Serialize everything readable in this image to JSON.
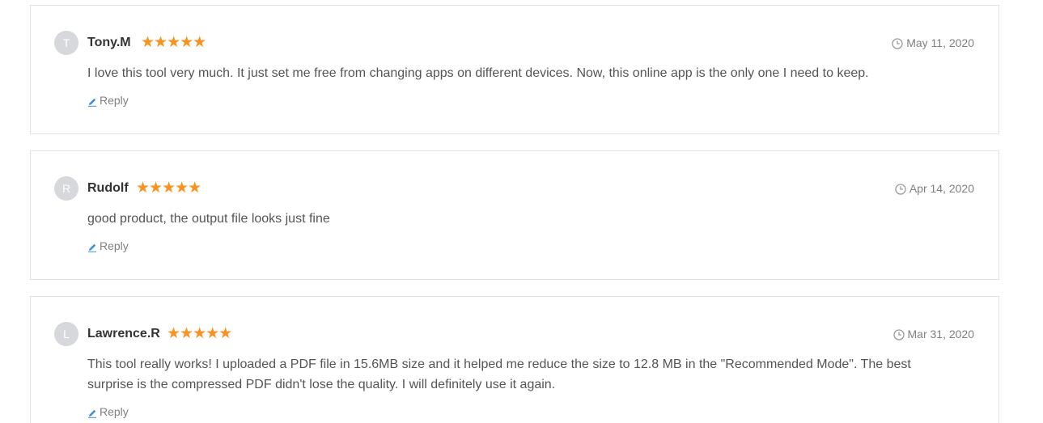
{
  "reviews": [
    {
      "initial": "T",
      "name": "Tony.M",
      "stars": "★★★★★",
      "rating": 5,
      "date": "May 11, 2020",
      "text": "I love this tool very much. It just set me free from changing apps on different devices. Now, this online app is the only one I need to keep.",
      "reply_label": "Reply"
    },
    {
      "initial": "R",
      "name": "Rudolf",
      "stars": "★★★★★",
      "rating": 5,
      "date": "Apr 14, 2020",
      "text": "good product, the output file looks just fine",
      "reply_label": "Reply"
    },
    {
      "initial": "L",
      "name": "Lawrence.R",
      "stars": "★★★★★",
      "rating": 5,
      "date": "Mar 31, 2020",
      "text": "This tool really works! I uploaded a PDF file in 15.6MB size and it helped me reduce the size to 12.8 MB in the \"Recommended Mode\". The best surprise is the compressed PDF didn't lose the quality. I will definitely use it again.",
      "reply_label": "Reply"
    }
  ],
  "icons": {
    "date": "clock-icon",
    "reply": "pencil-icon"
  },
  "colors": {
    "star": "#f7931e",
    "reply_icon": "#3b8fd9",
    "avatar_bg": "#d6d8dc"
  }
}
